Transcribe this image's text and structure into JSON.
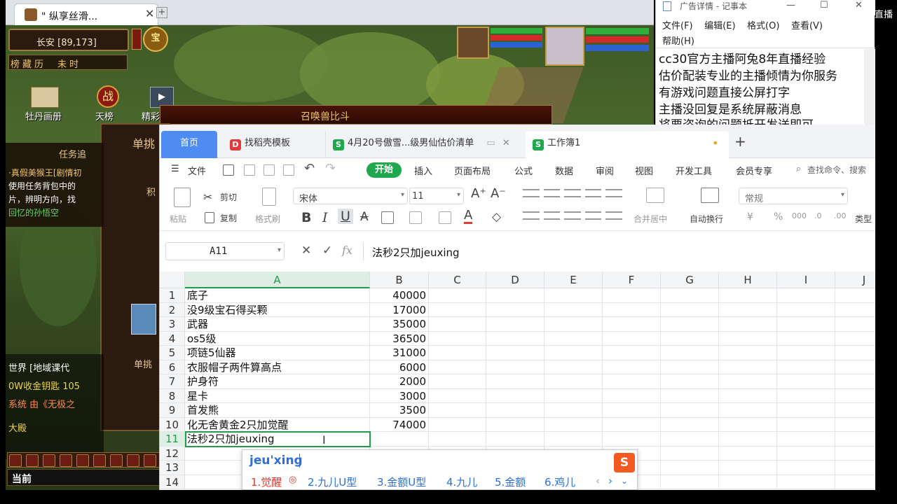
{
  "game": {
    "tab_title": "\" 纵享丝滑...",
    "location": "长安 [89,173]",
    "top_icons": [
      "榜",
      "藏",
      "历",
      "未",
      "时"
    ],
    "menu_labels": [
      "牡丹画册",
      "天榜",
      "精彩比赛"
    ],
    "banner_text": "召唤兽比斗",
    "panel_text": "单挑",
    "task_title": "任务追",
    "task_lines": [
      "·真假美猴王[剧情初",
      "使用任务背包中的",
      "片，辨明方向，找",
      "回忆的孙悟空"
    ],
    "chat_lines": [
      "世界 [地域课代",
      "0W收金钥匙 105",
      "系统 由《无极之",
      "大殿"
    ],
    "chat_prefix": "当前",
    "side_label1": "积",
    "side_label2": "单挑"
  },
  "notepad": {
    "title": "广告详情 - 记事本",
    "menu": [
      "文件(F)",
      "编辑(E)",
      "格式(O)",
      "查看(V)",
      "帮助(H)"
    ],
    "lines": [
      "cc30官方主播阿兔8年直播经验",
      "估价配装专业的主播倾情为你服务",
      "有游戏问题直接公屏打字",
      "主播没回复是系统屏蔽消息",
      "将要咨询的问题抵开发送即可"
    ],
    "overflow_text": "直播"
  },
  "sheet": {
    "tabs": [
      {
        "label": "首页"
      },
      {
        "label": "找稻壳模板"
      },
      {
        "label": "4月20号傲雪...级男仙估价清单"
      },
      {
        "label": "工作簿1"
      }
    ],
    "menu": [
      "文件",
      "开始",
      "插入",
      "页面布局",
      "公式",
      "数据",
      "审阅",
      "视图",
      "开发工具",
      "会员专享"
    ],
    "search_placeholder": "查找命令、搜索",
    "ribbon": {
      "paste": "粘贴",
      "cut": "剪切",
      "copy": "复制",
      "format_painter": "格式刷",
      "font": "宋体",
      "size": "11",
      "merge": "合并居中",
      "wrap": "自动换行",
      "number_format": "常规",
      "type_convert": "类型"
    },
    "name_box": "A11",
    "formula": "法秒2只加jeuxing",
    "columns": [
      "A",
      "B",
      "C",
      "D",
      "E",
      "F",
      "G",
      "H",
      "I",
      "J"
    ],
    "rows": [
      {
        "n": "1",
        "a": "底子",
        "b": "40000"
      },
      {
        "n": "2",
        "a": "没9级宝石得买颗",
        "b": "17000"
      },
      {
        "n": "3",
        "a": "武器",
        "b": "35000"
      },
      {
        "n": "4",
        "a": "os5级",
        "b": "36500"
      },
      {
        "n": "5",
        "a": "项链5仙器",
        "b": "31000"
      },
      {
        "n": "6",
        "a": "衣服帽子两件算高点",
        "b": "6000"
      },
      {
        "n": "7",
        "a": "护身符",
        "b": "2000"
      },
      {
        "n": "8",
        "a": "星卡",
        "b": "3000"
      },
      {
        "n": "9",
        "a": "首发熊",
        "b": "3500"
      },
      {
        "n": "10",
        "a": "化无舍黄金2只加觉醒",
        "b": "74000"
      },
      {
        "n": "11",
        "a": "法秒2只加jeuxing",
        "b": ""
      },
      {
        "n": "12",
        "a": "",
        "b": ""
      },
      {
        "n": "13",
        "a": "",
        "b": ""
      },
      {
        "n": "14",
        "a": "",
        "b": ""
      }
    ]
  },
  "ime": {
    "composition": "jeu'xing",
    "candidates": [
      "1.觉醒",
      "2.九儿U型",
      "3.金额U型",
      "4.九儿",
      "5.金额",
      "6.鸡儿"
    ]
  },
  "colors": {
    "accent": "#20a84f",
    "tab_active": "#4e8cf4",
    "selection": "#1e9e4a"
  }
}
